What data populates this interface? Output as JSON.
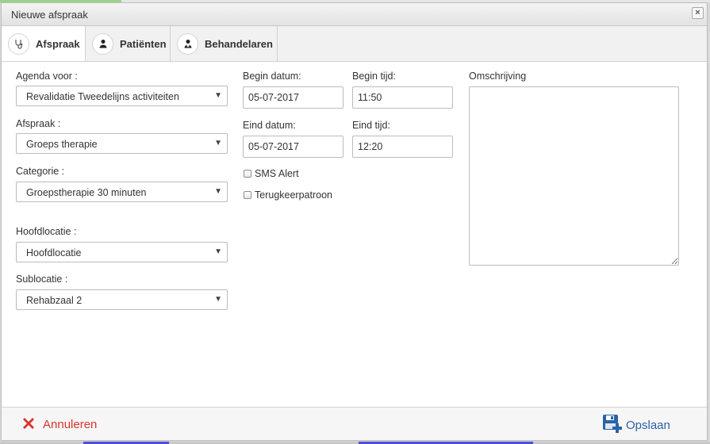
{
  "dialog": {
    "title": "Nieuwe afspraak",
    "close_glyph": "×"
  },
  "tabs": [
    {
      "label": "Afspraak",
      "icon": "stethoscope-icon",
      "active": true
    },
    {
      "label": "Patiënten",
      "icon": "user-icon",
      "active": false
    },
    {
      "label": "Behandelaren",
      "icon": "doctor-icon",
      "active": false
    }
  ],
  "form": {
    "agenda": {
      "label": "Agenda voor :",
      "value": "Revalidatie Tweedelijns activiteiten"
    },
    "afspraak": {
      "label": "Afspraak :",
      "value": "Groeps therapie"
    },
    "categorie": {
      "label": "Categorie :",
      "value": "Groepstherapie 30 minuten"
    },
    "hoofdlocatie": {
      "label": "Hoofdlocatie :",
      "value": "Hoofdlocatie"
    },
    "sublocatie": {
      "label": "Sublocatie :",
      "value": "Rehabzaal 2"
    },
    "begin_datum": {
      "label": "Begin datum:",
      "value": "05-07-2017"
    },
    "begin_tijd": {
      "label": "Begin tijd:",
      "value": "11:50"
    },
    "eind_datum": {
      "label": "Eind datum:",
      "value": "05-07-2017"
    },
    "eind_tijd": {
      "label": "Eind tijd:",
      "value": "12:20"
    },
    "sms_alert": {
      "label": "SMS Alert",
      "checked": false
    },
    "terugkeer": {
      "label": "Terugkeerpatroon",
      "checked": false
    },
    "omschrijving": {
      "label": "Omschrijving",
      "value": ""
    }
  },
  "footer": {
    "cancel_label": "Annuleren",
    "save_label": "Opslaan"
  },
  "colors": {
    "cancel": "#d9342b",
    "save": "#2a62a8"
  }
}
